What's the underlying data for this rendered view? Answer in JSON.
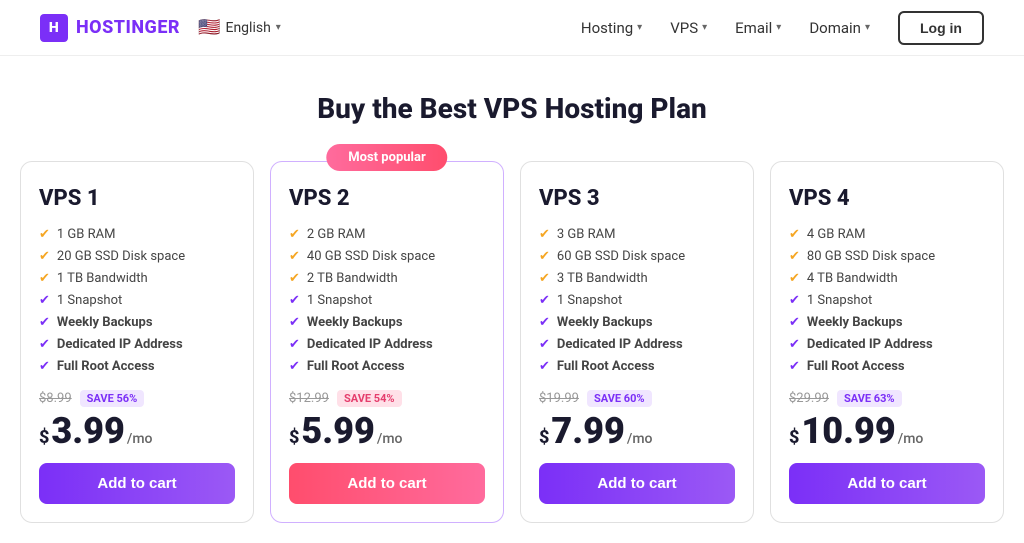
{
  "header": {
    "logo_text": "HOSTINGER",
    "logo_icon": "H",
    "lang": "English",
    "flag": "🇺🇸",
    "nav": [
      {
        "label": "Hosting",
        "id": "hosting"
      },
      {
        "label": "VPS",
        "id": "vps"
      },
      {
        "label": "Email",
        "id": "email"
      },
      {
        "label": "Domain",
        "id": "domain"
      }
    ],
    "login_label": "Log in"
  },
  "page": {
    "title": "Buy the Best VPS Hosting Plan"
  },
  "plans": [
    {
      "id": "vps1",
      "title": "VPS 1",
      "featured": false,
      "features": [
        {
          "text": "1 GB RAM",
          "bold": false,
          "check": "yellow"
        },
        {
          "text": "20 GB SSD Disk space",
          "bold": false,
          "check": "yellow"
        },
        {
          "text": "1 TB Bandwidth",
          "bold": false,
          "check": "yellow"
        },
        {
          "text": "1 Snapshot",
          "bold": false,
          "check": "green"
        },
        {
          "text": "Weekly Backups",
          "bold": true,
          "check": "green"
        },
        {
          "text": "Dedicated IP Address",
          "bold": true,
          "check": "green"
        },
        {
          "text": "Full Root Access",
          "bold": true,
          "check": "green"
        }
      ],
      "original_price": "$8.99",
      "save_label": "SAVE 56%",
      "save_pink": false,
      "currency": "$",
      "price": "3.99",
      "period": "/mo",
      "btn_label": "Add to cart",
      "btn_pink": false
    },
    {
      "id": "vps2",
      "title": "VPS 2",
      "featured": true,
      "most_popular": "Most popular",
      "features": [
        {
          "text": "2 GB RAM",
          "bold": false,
          "check": "yellow"
        },
        {
          "text": "40 GB SSD Disk space",
          "bold": false,
          "check": "yellow"
        },
        {
          "text": "2 TB Bandwidth",
          "bold": false,
          "check": "yellow"
        },
        {
          "text": "1 Snapshot",
          "bold": false,
          "check": "green"
        },
        {
          "text": "Weekly Backups",
          "bold": true,
          "check": "green"
        },
        {
          "text": "Dedicated IP Address",
          "bold": true,
          "check": "green"
        },
        {
          "text": "Full Root Access",
          "bold": true,
          "check": "green"
        }
      ],
      "original_price": "$12.99",
      "save_label": "SAVE 54%",
      "save_pink": true,
      "currency": "$",
      "price": "5.99",
      "period": "/mo",
      "btn_label": "Add to cart",
      "btn_pink": true
    },
    {
      "id": "vps3",
      "title": "VPS 3",
      "featured": false,
      "features": [
        {
          "text": "3 GB RAM",
          "bold": false,
          "check": "yellow"
        },
        {
          "text": "60 GB SSD Disk space",
          "bold": false,
          "check": "yellow"
        },
        {
          "text": "3 TB Bandwidth",
          "bold": false,
          "check": "yellow"
        },
        {
          "text": "1 Snapshot",
          "bold": false,
          "check": "green"
        },
        {
          "text": "Weekly Backups",
          "bold": true,
          "check": "green"
        },
        {
          "text": "Dedicated IP Address",
          "bold": true,
          "check": "green"
        },
        {
          "text": "Full Root Access",
          "bold": true,
          "check": "green"
        }
      ],
      "original_price": "$19.99",
      "save_label": "SAVE 60%",
      "save_pink": false,
      "currency": "$",
      "price": "7.99",
      "period": "/mo",
      "btn_label": "Add to cart",
      "btn_pink": false
    },
    {
      "id": "vps4",
      "title": "VPS 4",
      "featured": false,
      "features": [
        {
          "text": "4 GB RAM",
          "bold": false,
          "check": "yellow"
        },
        {
          "text": "80 GB SSD Disk space",
          "bold": false,
          "check": "yellow"
        },
        {
          "text": "4 TB Bandwidth",
          "bold": false,
          "check": "yellow"
        },
        {
          "text": "1 Snapshot",
          "bold": false,
          "check": "green"
        },
        {
          "text": "Weekly Backups",
          "bold": true,
          "check": "green"
        },
        {
          "text": "Dedicated IP Address",
          "bold": true,
          "check": "green"
        },
        {
          "text": "Full Root Access",
          "bold": true,
          "check": "green"
        }
      ],
      "original_price": "$29.99",
      "save_label": "SAVE 63%",
      "save_pink": false,
      "currency": "$",
      "price": "10.99",
      "period": "/mo",
      "btn_label": "Add to cart",
      "btn_pink": false
    }
  ]
}
